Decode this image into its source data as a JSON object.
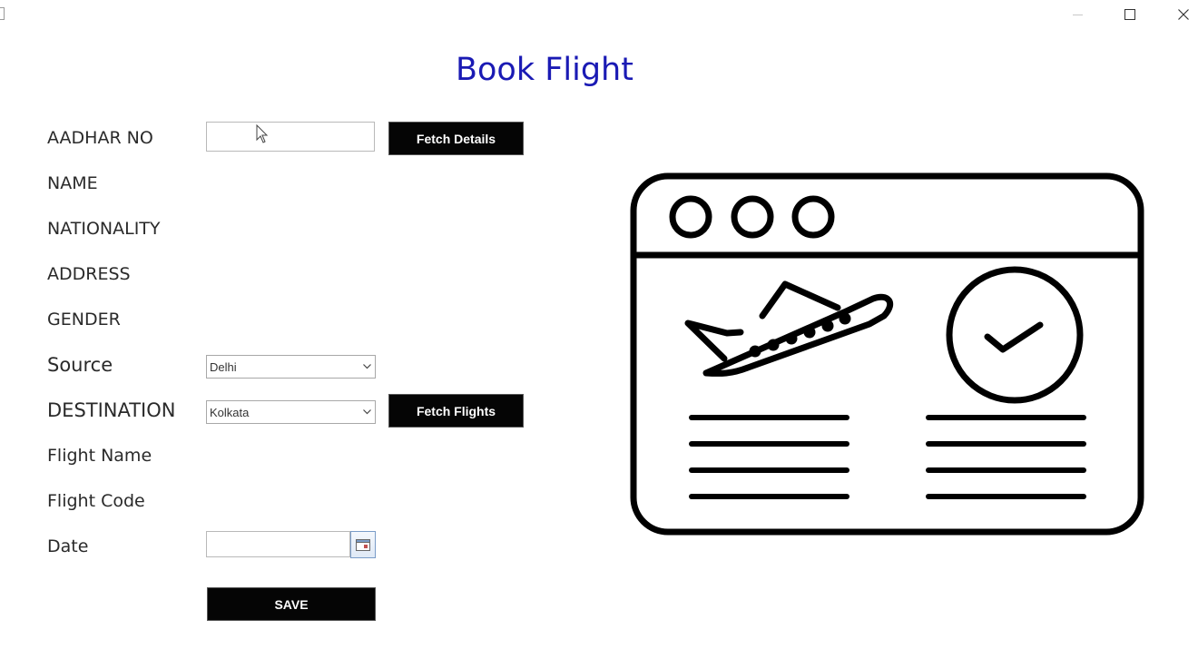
{
  "window": {
    "title": ""
  },
  "header": {
    "title": "Book Flight"
  },
  "form": {
    "aadhar_label": "AADHAR NO",
    "aadhar_value": "",
    "fetch_details_label": "Fetch Details",
    "name_label": "NAME",
    "nationality_label": "NATIONALITY",
    "address_label": "ADDRESS",
    "gender_label": "GENDER",
    "source_label": "Source",
    "source_value": "Delhi",
    "destination_label": "DESTINATION",
    "destination_value": "Kolkata",
    "fetch_flights_label": "Fetch Flights",
    "flight_name_label": "Flight Name",
    "flight_code_label": "Flight Code",
    "date_label": "Date",
    "date_value": "",
    "save_label": "SAVE"
  },
  "colors": {
    "title": "#1a1ab4",
    "button_bg": "#050505",
    "button_text": "#ffffff"
  },
  "icons": {
    "minimize": "minimize-icon",
    "maximize": "maximize-icon",
    "close": "close-icon",
    "dropdown": "chevron-down-icon",
    "calendar": "calendar-icon",
    "illustration": "flight-booking-illustration"
  }
}
